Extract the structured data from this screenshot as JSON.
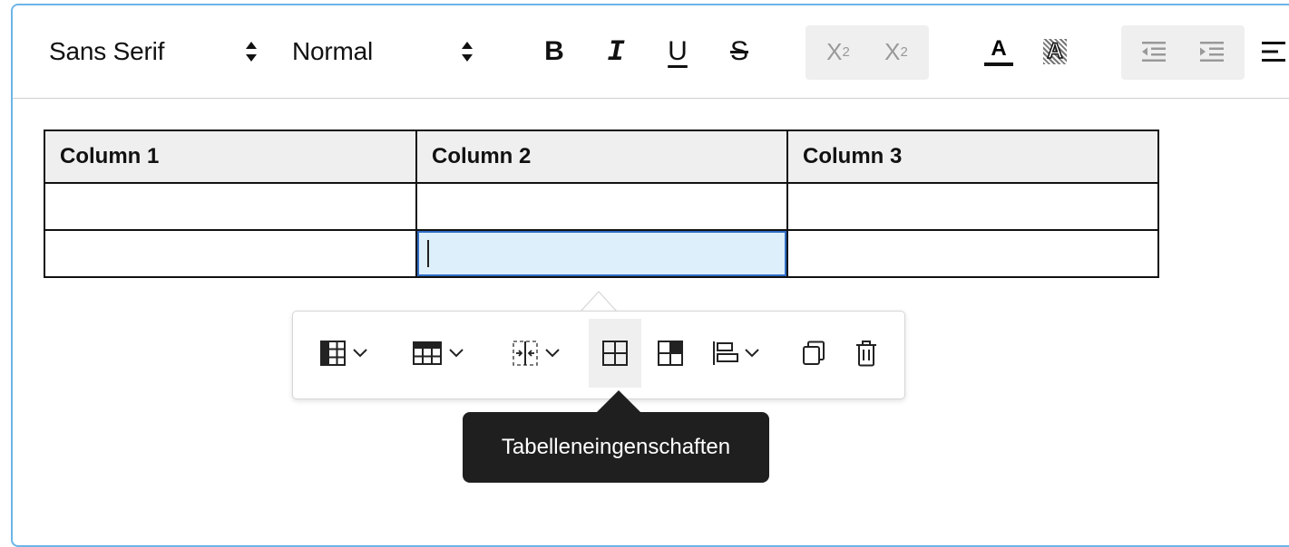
{
  "toolbar": {
    "font_select": {
      "value": "Sans Serif",
      "icon": "updown-arrows-icon"
    },
    "size_select": {
      "value": "Normal",
      "icon": "updown-arrows-icon"
    },
    "buttons": [
      {
        "name": "bold-button",
        "label": "B"
      },
      {
        "name": "italic-button",
        "label": "I"
      },
      {
        "name": "underline-button",
        "label": "U"
      },
      {
        "name": "strike-button",
        "label": "S"
      },
      {
        "name": "subscript-button",
        "label": "X",
        "script": "2"
      },
      {
        "name": "superscript-button",
        "label": "X",
        "script": "2"
      },
      {
        "name": "text-color-button",
        "label": "A"
      },
      {
        "name": "background-color-button",
        "label": "A"
      }
    ],
    "icons": [
      "outdent-icon",
      "indent-icon",
      "align-icon"
    ]
  },
  "table": {
    "headers": [
      "Column 1",
      "Column 2",
      "Column 3"
    ],
    "rows": [
      [
        "",
        "",
        ""
      ],
      [
        "",
        "",
        ""
      ]
    ],
    "active_cell": {
      "row": 2,
      "col": 2
    }
  },
  "table_toolbar": {
    "items": [
      {
        "name": "insert-table-grid-icon",
        "dropdown": true
      },
      {
        "name": "row-options-icon",
        "dropdown": true
      },
      {
        "name": "merge-cells-icon",
        "dropdown": true
      },
      {
        "name": "table-properties-icon",
        "dropdown": false,
        "hovered": true
      },
      {
        "name": "cell-properties-icon",
        "dropdown": false
      },
      {
        "name": "align-table-icon",
        "dropdown": true
      },
      {
        "name": "copy-table-icon",
        "dropdown": false
      },
      {
        "name": "delete-table-icon",
        "dropdown": false
      }
    ]
  },
  "tooltip": {
    "text": "Tabelleneingenschaften"
  },
  "colors": {
    "editor_border": "#6cb5e8",
    "active_cell_bg": "#dceffa",
    "active_cell_border": "#2f6cc4",
    "tooltip_bg": "#1f1f1f",
    "button_hover_bg": "#efefef"
  }
}
